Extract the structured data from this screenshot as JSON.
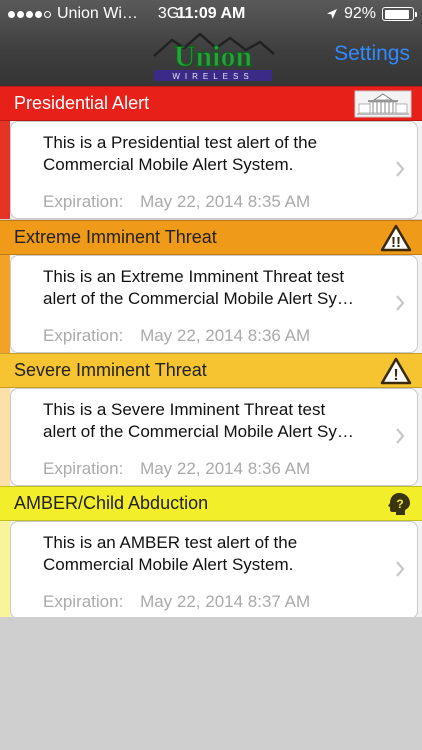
{
  "status_bar": {
    "carrier": "Union Wi…",
    "network": "3G",
    "time": "11:09 AM",
    "battery": "92%",
    "battery_level": 0.92,
    "signal_bars_filled": 4,
    "signal_bars_total": 5
  },
  "nav": {
    "logo_text": "Union",
    "logo_subtext": "WIRELESS",
    "settings_label": "Settings",
    "settings_color": "#2f8cff"
  },
  "alerts": [
    {
      "category": "Presidential Alert",
      "icon": "white-house-icon",
      "line1": "This is a Presidential test alert of the",
      "line2": "Commercial Mobile Alert System.",
      "expiration_label": "Expiration:",
      "expiration": "May 22, 2014 8:35 AM",
      "header_color": "#e8201a",
      "header_text_color": "#ffffff",
      "stripe_color": "#e53326"
    },
    {
      "category": "Extreme Imminent Threat",
      "icon": "double-exclamation-warning-icon",
      "line1": "This is an Extreme Imminent Threat test",
      "line2": "alert of the Commercial Mobile Alert Sy…",
      "expiration_label": "Expiration:",
      "expiration": "May 22, 2014 8:36 AM",
      "header_color": "#f09a1a",
      "header_text_color": "#222222",
      "stripe_color": "#f2a227"
    },
    {
      "category": "Severe Imminent Threat",
      "icon": "exclamation-warning-icon",
      "line1": "This is a Severe Imminent Threat test",
      "line2": "alert of the Commercial Mobile Alert Sy…",
      "expiration_label": "Expiration:",
      "expiration": "May 22, 2014 8:36 AM",
      "header_color": "#f5c430",
      "header_text_color": "#222222",
      "stripe_color": "#fbe1a8"
    },
    {
      "category": "AMBER/Child Abduction",
      "icon": "question-head-icon",
      "line1": "This is an AMBER test alert of the",
      "line2": "Commercial Mobile Alert System.",
      "expiration_label": "Expiration:",
      "expiration": "May 22, 2014 8:37 AM",
      "header_color": "#f2ee2a",
      "header_text_color": "#222222",
      "stripe_color": "#f7f49b"
    }
  ]
}
